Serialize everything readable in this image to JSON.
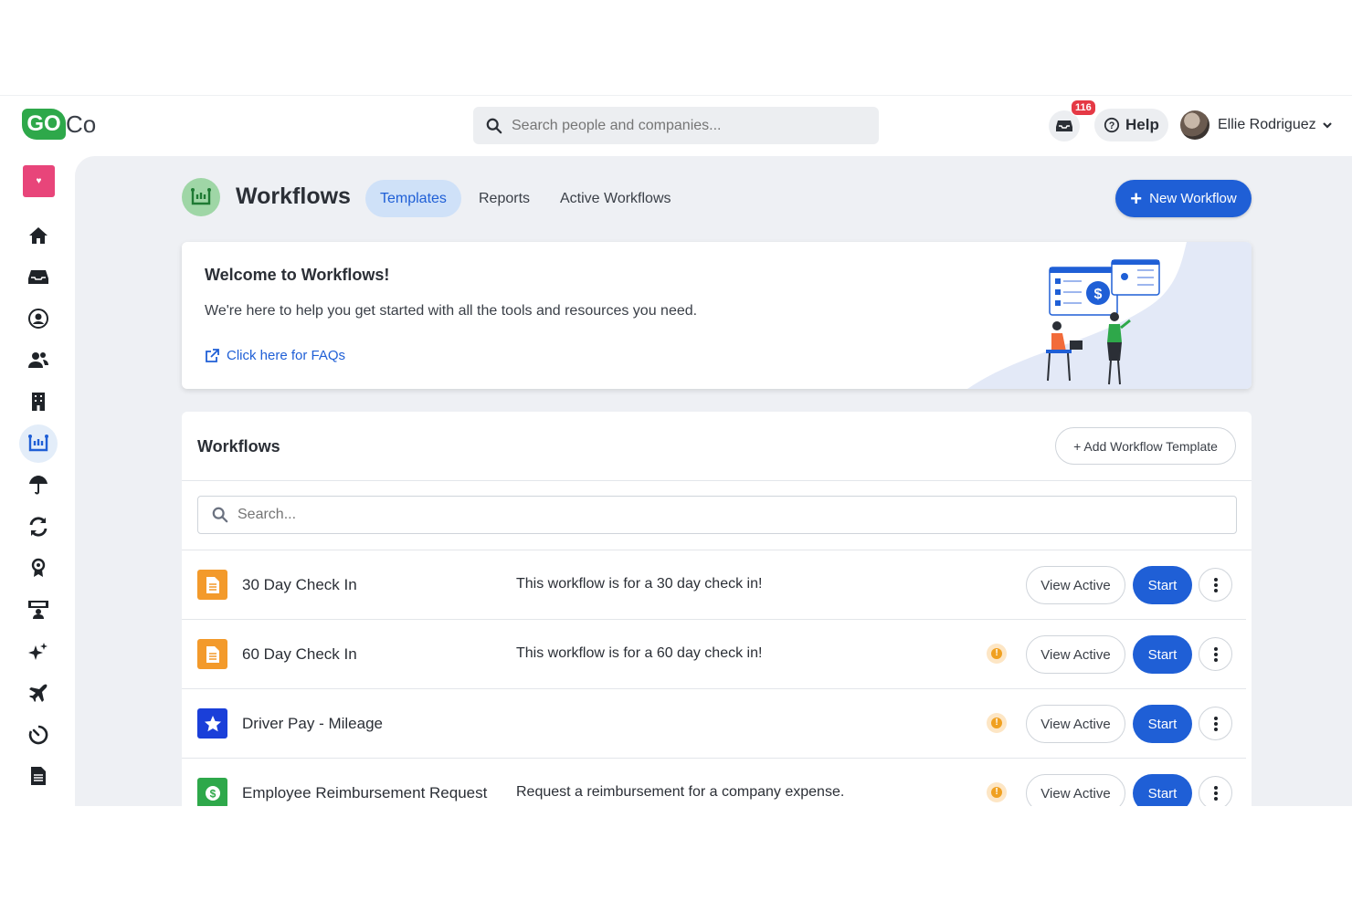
{
  "brand": {
    "logo_go": "GO",
    "logo_co": "Co",
    "color": "#2ea84a"
  },
  "topbar": {
    "search_placeholder": "Search people and companies...",
    "inbox_badge": "116",
    "help_label": "Help",
    "user_name": "Ellie Rodriguez"
  },
  "sidebar": {
    "items": [
      "home-icon",
      "inbox-icon",
      "person-circle-icon",
      "people-icon",
      "building-icon",
      "workflows-icon",
      "umbrella-icon",
      "sync-icon",
      "award-icon",
      "training-icon",
      "sparkles-icon",
      "plane-icon",
      "timer-icon",
      "document-icon"
    ],
    "active": "workflows-icon"
  },
  "header": {
    "title": "Workflows",
    "tabs": [
      {
        "label": "Templates",
        "active": true
      },
      {
        "label": "Reports",
        "active": false
      },
      {
        "label": "Active Workflows",
        "active": false
      }
    ],
    "new_button": "New Workflow"
  },
  "welcome": {
    "title": "Welcome to Workflows!",
    "description": "We're here to help you get started with all the tools and resources you need.",
    "faq_link": "Click here for FAQs"
  },
  "list": {
    "title": "Workflows",
    "add_button": "+ Add Workflow Template",
    "search_placeholder": "Search...",
    "view_label": "View Active",
    "start_label": "Start",
    "rows": [
      {
        "name": "30 Day Check In",
        "description": "This workflow is for a 30 day check in!",
        "icon": "document-icon",
        "icon_color": "#f39a2b",
        "warning": false
      },
      {
        "name": "60 Day Check In",
        "description": "This workflow is for a 60 day check in!",
        "icon": "document-icon",
        "icon_color": "#f39a2b",
        "warning": true
      },
      {
        "name": "Driver Pay - Mileage",
        "description": "",
        "icon": "star-icon",
        "icon_color": "#1a3fd9",
        "warning": true
      },
      {
        "name": "Employee Reimbursement Request",
        "description": "Request a reimbursement for a company expense.",
        "icon": "dollar-icon",
        "icon_color": "#2ea84a",
        "warning": true
      }
    ]
  },
  "colors": {
    "primary": "#1f5fd6",
    "tab_active_bg": "#cfe1f8",
    "warning": "#f0a020",
    "panel_bg": "#eef0f4"
  }
}
